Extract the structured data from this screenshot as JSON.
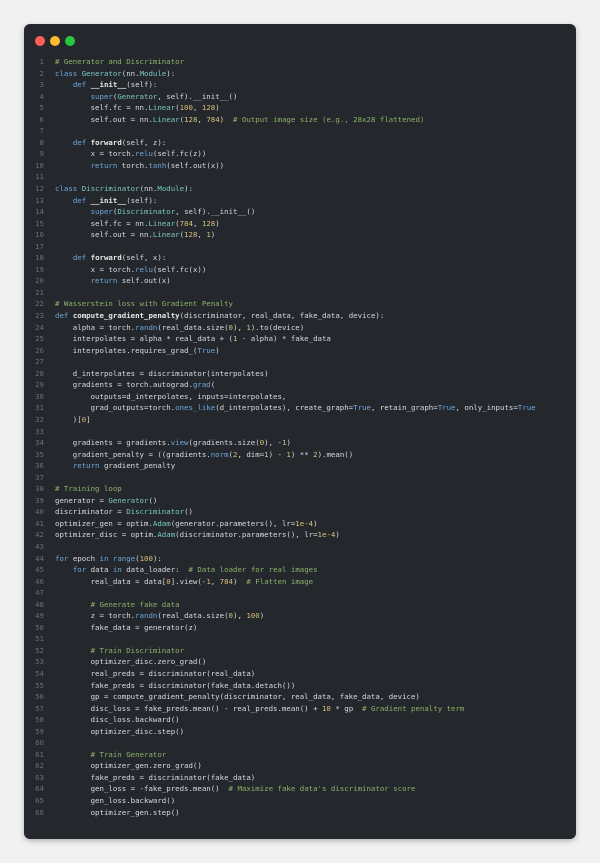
{
  "window": {
    "controls": [
      {
        "name": "close",
        "color": "#ff5f57"
      },
      {
        "name": "minimize",
        "color": "#febc2e"
      },
      {
        "name": "maximize",
        "color": "#28c840"
      }
    ]
  },
  "editor": {
    "lines": [
      {
        "n": "1",
        "tokens": [
          [
            "cm",
            "# Generator and Discriminator"
          ]
        ]
      },
      {
        "n": "2",
        "tokens": [
          [
            "kw",
            "class "
          ],
          [
            "cls",
            "Generator"
          ],
          [
            "t",
            "(nn."
          ],
          [
            "cls",
            "Module"
          ],
          [
            "t",
            "):"
          ]
        ]
      },
      {
        "n": "3",
        "tokens": [
          [
            "t",
            "    "
          ],
          [
            "kw",
            "def "
          ],
          [
            "fn",
            "__init__"
          ],
          [
            "t",
            "(self):"
          ]
        ]
      },
      {
        "n": "4",
        "tokens": [
          [
            "t",
            "        "
          ],
          [
            "bi",
            "super"
          ],
          [
            "t",
            "("
          ],
          [
            "cls",
            "Generator"
          ],
          [
            "t",
            ", self).__init__()"
          ]
        ]
      },
      {
        "n": "5",
        "tokens": [
          [
            "t",
            "        self.fc = nn."
          ],
          [
            "cls",
            "Linear"
          ],
          [
            "t",
            "("
          ],
          [
            "num",
            "100"
          ],
          [
            "t",
            ", "
          ],
          [
            "num",
            "128"
          ],
          [
            "t",
            ")"
          ]
        ]
      },
      {
        "n": "6",
        "tokens": [
          [
            "t",
            "        self.out = nn."
          ],
          [
            "cls",
            "Linear"
          ],
          [
            "t",
            "("
          ],
          [
            "num",
            "128"
          ],
          [
            "t",
            ", "
          ],
          [
            "num",
            "784"
          ],
          [
            "t",
            ")  "
          ],
          [
            "cm",
            "# Output image size (e.g., 28x28 flattened)"
          ]
        ]
      },
      {
        "n": "7",
        "tokens": []
      },
      {
        "n": "8",
        "tokens": [
          [
            "t",
            "    "
          ],
          [
            "kw",
            "def "
          ],
          [
            "fn",
            "forward"
          ],
          [
            "t",
            "(self, z):"
          ]
        ]
      },
      {
        "n": "9",
        "tokens": [
          [
            "t",
            "        x = torch."
          ],
          [
            "bi",
            "relu"
          ],
          [
            "t",
            "(self.fc(z))"
          ]
        ]
      },
      {
        "n": "10",
        "tokens": [
          [
            "t",
            "        "
          ],
          [
            "kw",
            "return "
          ],
          [
            "t",
            "torch."
          ],
          [
            "bi",
            "tanh"
          ],
          [
            "t",
            "(self.out(x))"
          ]
        ]
      },
      {
        "n": "11",
        "tokens": []
      },
      {
        "n": "12",
        "tokens": [
          [
            "kw",
            "class "
          ],
          [
            "cls",
            "Discriminator"
          ],
          [
            "t",
            "(nn."
          ],
          [
            "cls",
            "Module"
          ],
          [
            "t",
            "):"
          ]
        ]
      },
      {
        "n": "13",
        "tokens": [
          [
            "t",
            "    "
          ],
          [
            "kw",
            "def "
          ],
          [
            "fn",
            "__init__"
          ],
          [
            "t",
            "(self):"
          ]
        ]
      },
      {
        "n": "14",
        "tokens": [
          [
            "t",
            "        "
          ],
          [
            "bi",
            "super"
          ],
          [
            "t",
            "("
          ],
          [
            "cls",
            "Discriminator"
          ],
          [
            "t",
            ", self).__init__()"
          ]
        ]
      },
      {
        "n": "15",
        "tokens": [
          [
            "t",
            "        self.fc = nn."
          ],
          [
            "cls",
            "Linear"
          ],
          [
            "t",
            "("
          ],
          [
            "num",
            "784"
          ],
          [
            "t",
            ", "
          ],
          [
            "num",
            "128"
          ],
          [
            "t",
            ")"
          ]
        ]
      },
      {
        "n": "16",
        "tokens": [
          [
            "t",
            "        self.out = nn."
          ],
          [
            "cls",
            "Linear"
          ],
          [
            "t",
            "("
          ],
          [
            "num",
            "128"
          ],
          [
            "t",
            ", "
          ],
          [
            "num",
            "1"
          ],
          [
            "t",
            ")"
          ]
        ]
      },
      {
        "n": "17",
        "tokens": []
      },
      {
        "n": "18",
        "tokens": [
          [
            "t",
            "    "
          ],
          [
            "kw",
            "def "
          ],
          [
            "fn",
            "forward"
          ],
          [
            "t",
            "(self, x):"
          ]
        ]
      },
      {
        "n": "19",
        "tokens": [
          [
            "t",
            "        x = torch."
          ],
          [
            "bi",
            "relu"
          ],
          [
            "t",
            "(self.fc(x))"
          ]
        ]
      },
      {
        "n": "20",
        "tokens": [
          [
            "t",
            "        "
          ],
          [
            "kw",
            "return "
          ],
          [
            "t",
            "self.out(x)"
          ]
        ]
      },
      {
        "n": "21",
        "tokens": []
      },
      {
        "n": "22",
        "tokens": [
          [
            "cm",
            "# Wasserstein loss with Gradient Penalty"
          ]
        ]
      },
      {
        "n": "23",
        "tokens": [
          [
            "kw",
            "def "
          ],
          [
            "fn",
            "compute_gradient_penalty"
          ],
          [
            "t",
            "(discriminator, real_data, fake_data, device):"
          ]
        ]
      },
      {
        "n": "24",
        "tokens": [
          [
            "t",
            "    alpha = torch."
          ],
          [
            "bi",
            "randn"
          ],
          [
            "t",
            "(real_data.size("
          ],
          [
            "num",
            "0"
          ],
          [
            "t",
            "), "
          ],
          [
            "num",
            "1"
          ],
          [
            "t",
            ").to(device)"
          ]
        ]
      },
      {
        "n": "25",
        "tokens": [
          [
            "t",
            "    interpolates = alpha * real_data + ("
          ],
          [
            "num",
            "1"
          ],
          [
            "t",
            " - alpha) * fake_data"
          ]
        ]
      },
      {
        "n": "26",
        "tokens": [
          [
            "t",
            "    interpolates.requires_grad_("
          ],
          [
            "kw",
            "True"
          ],
          [
            "t",
            ")"
          ]
        ]
      },
      {
        "n": "27",
        "tokens": []
      },
      {
        "n": "28",
        "tokens": [
          [
            "t",
            "    d_interpolates = discriminator(interpolates)"
          ]
        ]
      },
      {
        "n": "29",
        "tokens": [
          [
            "t",
            "    gradients = torch.autograd."
          ],
          [
            "bi",
            "grad"
          ],
          [
            "t",
            "("
          ]
        ]
      },
      {
        "n": "30",
        "tokens": [
          [
            "t",
            "        outputs=d_interpolates, inputs=interpolates,"
          ]
        ]
      },
      {
        "n": "31",
        "tokens": [
          [
            "t",
            "        grad_outputs=torch."
          ],
          [
            "bi",
            "ones_like"
          ],
          [
            "t",
            "(d_interpolates), create_graph="
          ],
          [
            "kw",
            "True"
          ],
          [
            "t",
            ", retain_graph="
          ],
          [
            "kw",
            "True"
          ],
          [
            "t",
            ", only_inputs="
          ],
          [
            "kw",
            "True"
          ]
        ]
      },
      {
        "n": "32",
        "tokens": [
          [
            "t",
            "    )["
          ],
          [
            "num",
            "0"
          ],
          [
            "t",
            "]"
          ]
        ]
      },
      {
        "n": "33",
        "tokens": []
      },
      {
        "n": "34",
        "tokens": [
          [
            "t",
            "    gradients = gradients."
          ],
          [
            "bi",
            "view"
          ],
          [
            "t",
            "(gradients.size("
          ],
          [
            "num",
            "0"
          ],
          [
            "t",
            "), -"
          ],
          [
            "num",
            "1"
          ],
          [
            "t",
            ")"
          ]
        ]
      },
      {
        "n": "35",
        "tokens": [
          [
            "t",
            "    gradient_penalty = ((gradients."
          ],
          [
            "bi",
            "norm"
          ],
          [
            "t",
            "("
          ],
          [
            "num",
            "2"
          ],
          [
            "t",
            ", dim="
          ],
          [
            "num",
            "1"
          ],
          [
            "t",
            ") - "
          ],
          [
            "num",
            "1"
          ],
          [
            "t",
            ") ** "
          ],
          [
            "num",
            "2"
          ],
          [
            "t",
            ").mean()"
          ]
        ]
      },
      {
        "n": "36",
        "tokens": [
          [
            "t",
            "    "
          ],
          [
            "kw",
            "return "
          ],
          [
            "t",
            "gradient_penalty"
          ]
        ]
      },
      {
        "n": "37",
        "tokens": []
      },
      {
        "n": "38",
        "tokens": [
          [
            "cm",
            "# Training loop"
          ]
        ]
      },
      {
        "n": "39",
        "tokens": [
          [
            "t",
            "generator = "
          ],
          [
            "cls",
            "Generator"
          ],
          [
            "t",
            "()"
          ]
        ]
      },
      {
        "n": "40",
        "tokens": [
          [
            "t",
            "discriminator = "
          ],
          [
            "cls",
            "Discriminator"
          ],
          [
            "t",
            "()"
          ]
        ]
      },
      {
        "n": "41",
        "tokens": [
          [
            "t",
            "optimizer_gen = optim."
          ],
          [
            "cls",
            "Adam"
          ],
          [
            "t",
            "(generator.parameters(), lr="
          ],
          [
            "num",
            "1e-4"
          ],
          [
            "t",
            ")"
          ]
        ]
      },
      {
        "n": "42",
        "tokens": [
          [
            "t",
            "optimizer_disc = optim."
          ],
          [
            "cls",
            "Adam"
          ],
          [
            "t",
            "(discriminator.parameters(), lr="
          ],
          [
            "num",
            "1e-4"
          ],
          [
            "t",
            ")"
          ]
        ]
      },
      {
        "n": "43",
        "tokens": []
      },
      {
        "n": "44",
        "tokens": [
          [
            "kw",
            "for "
          ],
          [
            "t",
            "epoch "
          ],
          [
            "kw",
            "in "
          ],
          [
            "bi",
            "range"
          ],
          [
            "t",
            "("
          ],
          [
            "num",
            "100"
          ],
          [
            "t",
            "):"
          ]
        ]
      },
      {
        "n": "45",
        "tokens": [
          [
            "t",
            "    "
          ],
          [
            "kw",
            "for "
          ],
          [
            "t",
            "data "
          ],
          [
            "kw",
            "in "
          ],
          [
            "t",
            "data_loader:  "
          ],
          [
            "cm",
            "# Data loader for real images"
          ]
        ]
      },
      {
        "n": "46",
        "tokens": [
          [
            "t",
            "        real_data = data["
          ],
          [
            "num",
            "0"
          ],
          [
            "t",
            "].view(-"
          ],
          [
            "num",
            "1"
          ],
          [
            "t",
            ", "
          ],
          [
            "num",
            "784"
          ],
          [
            "t",
            ")  "
          ],
          [
            "cm",
            "# Flatten image"
          ]
        ]
      },
      {
        "n": "47",
        "tokens": []
      },
      {
        "n": "48",
        "tokens": [
          [
            "t",
            "        "
          ],
          [
            "cm",
            "# Generate fake data"
          ]
        ]
      },
      {
        "n": "49",
        "tokens": [
          [
            "t",
            "        z = torch."
          ],
          [
            "bi",
            "randn"
          ],
          [
            "t",
            "(real_data.size("
          ],
          [
            "num",
            "0"
          ],
          [
            "t",
            "), "
          ],
          [
            "num",
            "100"
          ],
          [
            "t",
            ")"
          ]
        ]
      },
      {
        "n": "50",
        "tokens": [
          [
            "t",
            "        fake_data = generator(z)"
          ]
        ]
      },
      {
        "n": "51",
        "tokens": []
      },
      {
        "n": "52",
        "tokens": [
          [
            "t",
            "        "
          ],
          [
            "cm",
            "# Train Discriminator"
          ]
        ]
      },
      {
        "n": "53",
        "tokens": [
          [
            "t",
            "        optimizer_disc.zero_grad()"
          ]
        ]
      },
      {
        "n": "54",
        "tokens": [
          [
            "t",
            "        real_preds = discriminator(real_data)"
          ]
        ]
      },
      {
        "n": "55",
        "tokens": [
          [
            "t",
            "        fake_preds = discriminator(fake_data.detach())"
          ]
        ]
      },
      {
        "n": "56",
        "tokens": [
          [
            "t",
            "        gp = compute_gradient_penalty(discriminator, real_data, fake_data, device)"
          ]
        ]
      },
      {
        "n": "57",
        "tokens": [
          [
            "t",
            "        disc_loss = fake_preds.mean() - real_preds.mean() + "
          ],
          [
            "num",
            "10"
          ],
          [
            "t",
            " * gp  "
          ],
          [
            "cm",
            "# Gradient penalty term"
          ]
        ]
      },
      {
        "n": "58",
        "tokens": [
          [
            "t",
            "        disc_loss.backward()"
          ]
        ]
      },
      {
        "n": "59",
        "tokens": [
          [
            "t",
            "        optimizer_disc.step()"
          ]
        ]
      },
      {
        "n": "60",
        "tokens": []
      },
      {
        "n": "61",
        "tokens": [
          [
            "t",
            "        "
          ],
          [
            "cm",
            "# Train Generator"
          ]
        ]
      },
      {
        "n": "62",
        "tokens": [
          [
            "t",
            "        optimizer_gen.zero_grad()"
          ]
        ]
      },
      {
        "n": "63",
        "tokens": [
          [
            "t",
            "        fake_preds = discriminator(fake_data)"
          ]
        ]
      },
      {
        "n": "64",
        "tokens": [
          [
            "t",
            "        gen_loss = -fake_preds.mean()  "
          ],
          [
            "cm",
            "# Maximize fake data's discriminator score"
          ]
        ]
      },
      {
        "n": "65",
        "tokens": [
          [
            "t",
            "        gen_loss.backward()"
          ]
        ]
      },
      {
        "n": "66",
        "tokens": [
          [
            "t",
            "        optimizer_gen.step()"
          ]
        ]
      }
    ]
  }
}
